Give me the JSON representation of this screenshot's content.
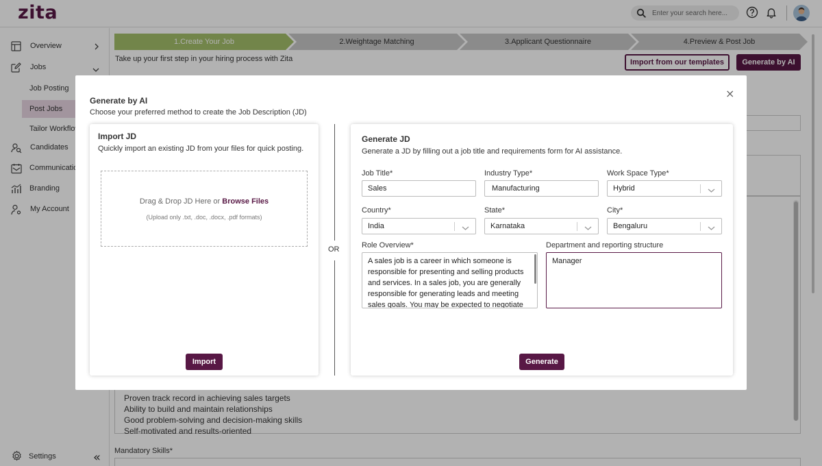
{
  "app": {
    "logo": "zita"
  },
  "header": {
    "search_placeholder": "Enter your search here..."
  },
  "sidebar": {
    "items": [
      {
        "label": "Overview"
      },
      {
        "label": "Jobs"
      },
      {
        "label": "Candidates"
      },
      {
        "label": "Communication"
      },
      {
        "label": "Branding"
      },
      {
        "label": "My Account"
      }
    ],
    "jobs_sub": [
      {
        "label": "Job Posting"
      },
      {
        "label": "Post Jobs",
        "active": true
      },
      {
        "label": "Tailor Workflow"
      }
    ],
    "settings": "Settings"
  },
  "steps": [
    {
      "label": "1.Create Your Job",
      "active": true
    },
    {
      "label": "2.Weightage Matching"
    },
    {
      "label": "3.Applicant Questionnaire"
    },
    {
      "label": "4.Preview & Post Job"
    }
  ],
  "intro": "Take up your first step in your hiring process with Zita",
  "buttons": {
    "import_templates": "Import from our templates",
    "generate_ai": "Generate by AI"
  },
  "background": {
    "list": [
      "Proven track record in achieving sales targets",
      "Ability to build and maintain relationships",
      "Good problem-solving and decision-making skills",
      "Self-motivated and results-oriented"
    ],
    "mandatory_label": "Mandatory Skills",
    "required_mark": "*"
  },
  "modal": {
    "title": "Generate by AI",
    "subtitle": "Choose your preferred method to create the Job Description (JD)",
    "close": "×",
    "or": "OR",
    "import": {
      "title": "Import JD",
      "subtitle": "Quickly import an existing JD from your files for quick posting.",
      "drop_text": "Drag & Drop JD Here or",
      "browse": "Browse Files",
      "formats": "(Upload only .txt, .doc, .docx, .pdf formats)",
      "button": "Import"
    },
    "generate": {
      "title": "Generate JD",
      "subtitle": "Generate a JD by filling out a job title and requirements form for AI assistance.",
      "fields": {
        "job_title": {
          "label": "Job Title",
          "value": "Sales"
        },
        "industry": {
          "label": "Industry Type",
          "value": "Manufacturing"
        },
        "workspace": {
          "label": "Work Space Type",
          "value": "Hybrid"
        },
        "country": {
          "label": "Country",
          "value": "India"
        },
        "state": {
          "label": "State",
          "value": "Karnataka"
        },
        "city": {
          "label": "City",
          "value": "Bengaluru"
        },
        "role_overview": {
          "label": "Role Overview",
          "value": "A sales job is a career in which someone is responsible for presenting and selling products and services. In a sales job, you are generally responsible for generating leads and meeting sales goals. You may be expected to negotiate"
        },
        "department": {
          "label": "Department and reporting structure",
          "value": "Manager"
        }
      },
      "required_mark": "*",
      "button": "Generate"
    }
  },
  "colors": {
    "brand": "#581845",
    "step_active": "#a4bf6a",
    "step_inactive": "#c8c8c8"
  }
}
